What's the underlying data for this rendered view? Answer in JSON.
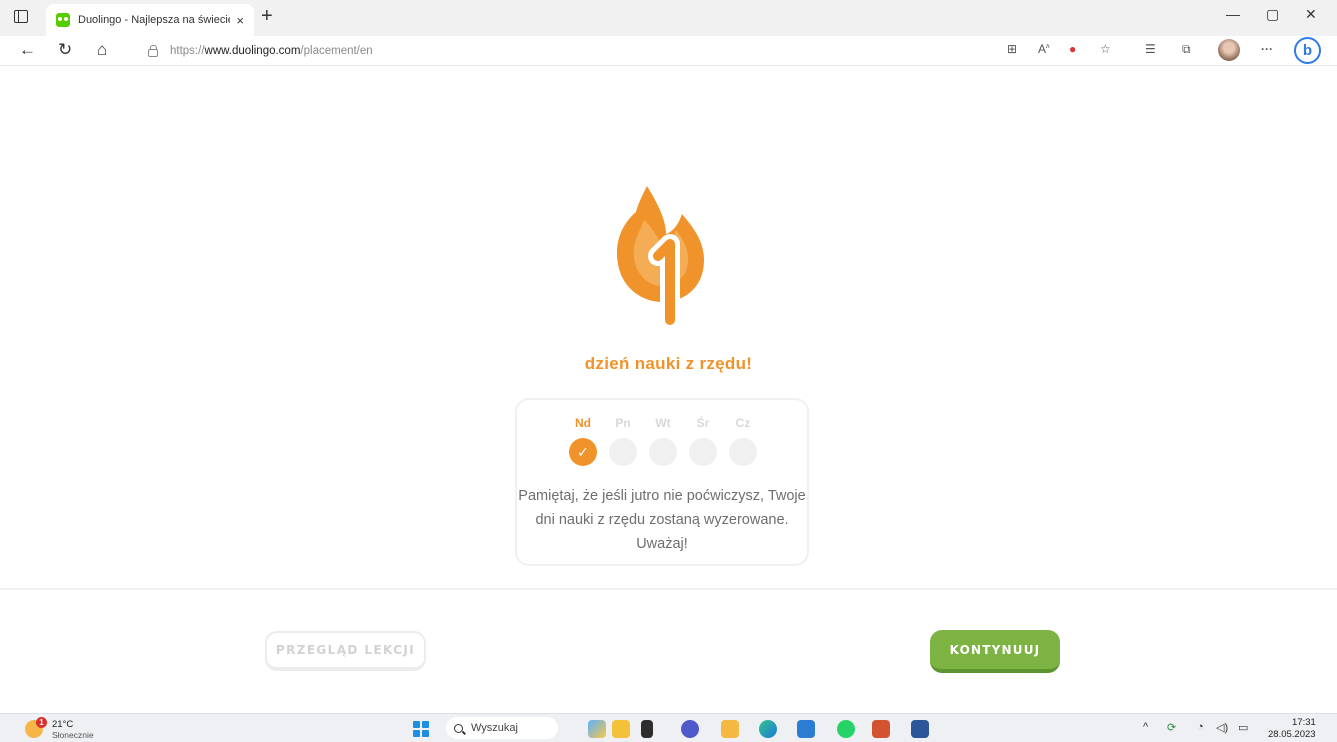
{
  "browser": {
    "tab_title": "Duolingo - Najlepsza na świecie",
    "tab_close": "×",
    "new_tab": "+",
    "window_controls": {
      "minimize": "—",
      "maximize": "▢",
      "close": "✕"
    },
    "nav": {
      "back": "←",
      "reload": "↻",
      "home": "⌂"
    },
    "url": {
      "scheme": "https://",
      "domain": "www.duolingo.com",
      "path": "/placement/en"
    },
    "toolbar_icons": [
      "apps-icon",
      "read-aloud-icon",
      "tracking-icon",
      "favorites-add-icon",
      "favorites-icon",
      "collections-icon",
      "profile-icon",
      "more-icon",
      "bing-icon"
    ],
    "more_label": "···",
    "bing_label": "b"
  },
  "streak": {
    "count": "1",
    "heading": "dzień nauki z rzędu!",
    "days": [
      {
        "label": "Nd",
        "done": true,
        "check": "✓"
      },
      {
        "label": "Pn",
        "done": false,
        "check": ""
      },
      {
        "label": "Wt",
        "done": false,
        "check": ""
      },
      {
        "label": "Śr",
        "done": false,
        "check": ""
      },
      {
        "label": "Cz",
        "done": false,
        "check": ""
      }
    ],
    "reminder": "Pamiętaj, że jeśli jutro nie poćwiczysz, Twoje dni nauki z rzędu zostaną wyzerowane. Uważaj!",
    "flame_color": "#f0932b",
    "accent_color": "#f0932b"
  },
  "footer": {
    "review_label": "PRZEGLĄD LEKCJI",
    "continue_label": "KONTYNUUJ",
    "continue_color": "#7cb342"
  },
  "taskbar": {
    "weather_badge": "1",
    "weather_temp": "21°C",
    "weather_desc": "Słonecznie",
    "search_placeholder": "Wyszukaj",
    "apps": [
      "start-icon",
      "widgets-icon",
      "file-explorer-icon",
      "app-icon",
      "teams-icon",
      "folder-icon",
      "edge-icon",
      "office-icon",
      "whatsapp-icon",
      "powerpoint-icon",
      "word-icon"
    ],
    "tray_chevron": "^",
    "clock_time": "17:31",
    "clock_date": "28.05.2023"
  }
}
